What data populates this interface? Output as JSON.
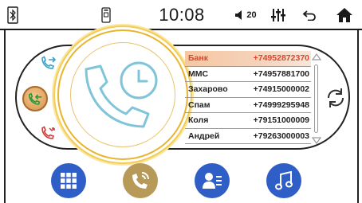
{
  "status_bar": {
    "time": "10:08",
    "volume_level": "20",
    "icons": [
      "bluetooth-icon",
      "phone-sim-icon",
      "volume-icon",
      "equalizer-icon",
      "back-icon",
      "home-icon"
    ]
  },
  "phone": {
    "side_buttons": [
      "outgoing-call-icon",
      "incoming-call-icon",
      "missed-call-icon"
    ],
    "active_side_button": "incoming-call-icon",
    "center_icon": "phone-history-icon",
    "contacts": [
      {
        "name": "Банк",
        "phone": "+74952872370",
        "selected": true
      },
      {
        "name": "MMC",
        "phone": "+74957881700",
        "selected": false
      },
      {
        "name": "Захарово",
        "phone": "+74915000002",
        "selected": false
      },
      {
        "name": "Спам",
        "phone": "+74999295948",
        "selected": false
      },
      {
        "name": "Коля",
        "phone": "+79151000009",
        "selected": false
      },
      {
        "name": "Андрей",
        "phone": "+79263000003",
        "selected": false
      }
    ],
    "sync_icon": "sync-icon"
  },
  "bottom_bar": {
    "buttons": [
      "keypad-icon",
      "call-log-icon",
      "contacts-icon",
      "music-icon"
    ]
  },
  "colors": {
    "accent_blue": "#2f5ec6",
    "accent_gold": "#b79a58",
    "selected_row": "#f6c7a2",
    "selected_text": "#d9472f",
    "ring_gold": "#e9b32b",
    "icon_cyan": "#3aa0c8"
  }
}
